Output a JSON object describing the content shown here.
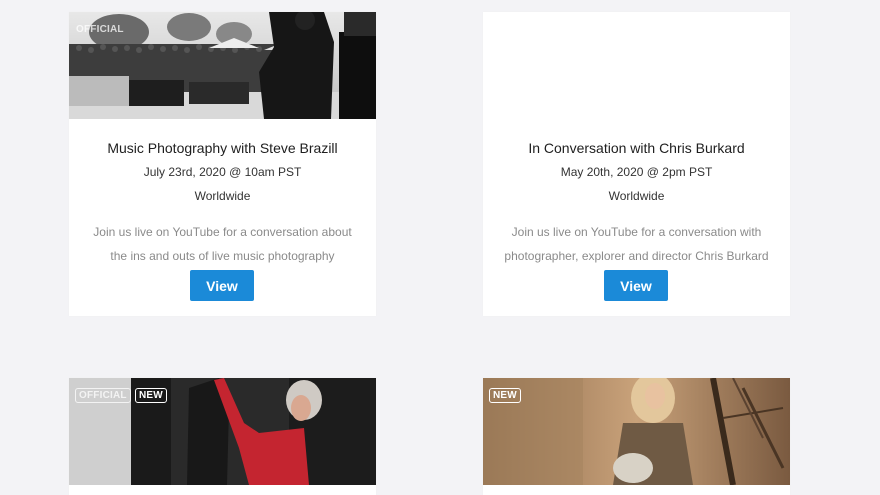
{
  "cards": [
    {
      "badges": [
        "OFFICIAL"
      ],
      "title": "Music Photography with Steve Brazill",
      "date": "July 23rd, 2020 @ 10am PST",
      "region": "Worldwide",
      "desc_line1": "Join us live on YouTube for a conversation about",
      "desc_line2": "the ins and outs of live music photography",
      "button": "View"
    },
    {
      "badges": [],
      "title": "In Conversation with Chris Burkard",
      "date": "May 20th, 2020 @ 2pm PST",
      "region": "Worldwide",
      "desc_line1": "Join us live on YouTube for a conversation with",
      "desc_line2": "photographer, explorer and director Chris Burkard",
      "button": "View"
    },
    {
      "badges": [
        "OFFICIAL",
        "NEW"
      ]
    },
    {
      "badges": [
        "NEW"
      ]
    }
  ],
  "colors": {
    "page_bg": "#f3f3f6",
    "card_bg": "#ffffff",
    "button": "#1b8ad8"
  }
}
